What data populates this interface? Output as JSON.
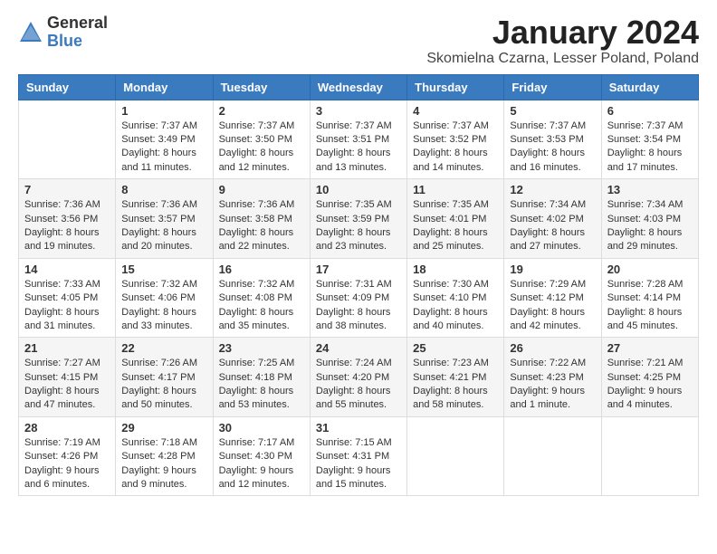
{
  "header": {
    "logo_general": "General",
    "logo_blue": "Blue",
    "month_title": "January 2024",
    "subtitle": "Skomielna Czarna, Lesser Poland, Poland"
  },
  "weekdays": [
    "Sunday",
    "Monday",
    "Tuesday",
    "Wednesday",
    "Thursday",
    "Friday",
    "Saturday"
  ],
  "weeks": [
    [
      {
        "day": "",
        "info": ""
      },
      {
        "day": "1",
        "info": "Sunrise: 7:37 AM\nSunset: 3:49 PM\nDaylight: 8 hours\nand 11 minutes."
      },
      {
        "day": "2",
        "info": "Sunrise: 7:37 AM\nSunset: 3:50 PM\nDaylight: 8 hours\nand 12 minutes."
      },
      {
        "day": "3",
        "info": "Sunrise: 7:37 AM\nSunset: 3:51 PM\nDaylight: 8 hours\nand 13 minutes."
      },
      {
        "day": "4",
        "info": "Sunrise: 7:37 AM\nSunset: 3:52 PM\nDaylight: 8 hours\nand 14 minutes."
      },
      {
        "day": "5",
        "info": "Sunrise: 7:37 AM\nSunset: 3:53 PM\nDaylight: 8 hours\nand 16 minutes."
      },
      {
        "day": "6",
        "info": "Sunrise: 7:37 AM\nSunset: 3:54 PM\nDaylight: 8 hours\nand 17 minutes."
      }
    ],
    [
      {
        "day": "7",
        "info": "Sunrise: 7:36 AM\nSunset: 3:56 PM\nDaylight: 8 hours\nand 19 minutes."
      },
      {
        "day": "8",
        "info": "Sunrise: 7:36 AM\nSunset: 3:57 PM\nDaylight: 8 hours\nand 20 minutes."
      },
      {
        "day": "9",
        "info": "Sunrise: 7:36 AM\nSunset: 3:58 PM\nDaylight: 8 hours\nand 22 minutes."
      },
      {
        "day": "10",
        "info": "Sunrise: 7:35 AM\nSunset: 3:59 PM\nDaylight: 8 hours\nand 23 minutes."
      },
      {
        "day": "11",
        "info": "Sunrise: 7:35 AM\nSunset: 4:01 PM\nDaylight: 8 hours\nand 25 minutes."
      },
      {
        "day": "12",
        "info": "Sunrise: 7:34 AM\nSunset: 4:02 PM\nDaylight: 8 hours\nand 27 minutes."
      },
      {
        "day": "13",
        "info": "Sunrise: 7:34 AM\nSunset: 4:03 PM\nDaylight: 8 hours\nand 29 minutes."
      }
    ],
    [
      {
        "day": "14",
        "info": "Sunrise: 7:33 AM\nSunset: 4:05 PM\nDaylight: 8 hours\nand 31 minutes."
      },
      {
        "day": "15",
        "info": "Sunrise: 7:32 AM\nSunset: 4:06 PM\nDaylight: 8 hours\nand 33 minutes."
      },
      {
        "day": "16",
        "info": "Sunrise: 7:32 AM\nSunset: 4:08 PM\nDaylight: 8 hours\nand 35 minutes."
      },
      {
        "day": "17",
        "info": "Sunrise: 7:31 AM\nSunset: 4:09 PM\nDaylight: 8 hours\nand 38 minutes."
      },
      {
        "day": "18",
        "info": "Sunrise: 7:30 AM\nSunset: 4:10 PM\nDaylight: 8 hours\nand 40 minutes."
      },
      {
        "day": "19",
        "info": "Sunrise: 7:29 AM\nSunset: 4:12 PM\nDaylight: 8 hours\nand 42 minutes."
      },
      {
        "day": "20",
        "info": "Sunrise: 7:28 AM\nSunset: 4:14 PM\nDaylight: 8 hours\nand 45 minutes."
      }
    ],
    [
      {
        "day": "21",
        "info": "Sunrise: 7:27 AM\nSunset: 4:15 PM\nDaylight: 8 hours\nand 47 minutes."
      },
      {
        "day": "22",
        "info": "Sunrise: 7:26 AM\nSunset: 4:17 PM\nDaylight: 8 hours\nand 50 minutes."
      },
      {
        "day": "23",
        "info": "Sunrise: 7:25 AM\nSunset: 4:18 PM\nDaylight: 8 hours\nand 53 minutes."
      },
      {
        "day": "24",
        "info": "Sunrise: 7:24 AM\nSunset: 4:20 PM\nDaylight: 8 hours\nand 55 minutes."
      },
      {
        "day": "25",
        "info": "Sunrise: 7:23 AM\nSunset: 4:21 PM\nDaylight: 8 hours\nand 58 minutes."
      },
      {
        "day": "26",
        "info": "Sunrise: 7:22 AM\nSunset: 4:23 PM\nDaylight: 9 hours\nand 1 minute."
      },
      {
        "day": "27",
        "info": "Sunrise: 7:21 AM\nSunset: 4:25 PM\nDaylight: 9 hours\nand 4 minutes."
      }
    ],
    [
      {
        "day": "28",
        "info": "Sunrise: 7:19 AM\nSunset: 4:26 PM\nDaylight: 9 hours\nand 6 minutes."
      },
      {
        "day": "29",
        "info": "Sunrise: 7:18 AM\nSunset: 4:28 PM\nDaylight: 9 hours\nand 9 minutes."
      },
      {
        "day": "30",
        "info": "Sunrise: 7:17 AM\nSunset: 4:30 PM\nDaylight: 9 hours\nand 12 minutes."
      },
      {
        "day": "31",
        "info": "Sunrise: 7:15 AM\nSunset: 4:31 PM\nDaylight: 9 hours\nand 15 minutes."
      },
      {
        "day": "",
        "info": ""
      },
      {
        "day": "",
        "info": ""
      },
      {
        "day": "",
        "info": ""
      }
    ]
  ]
}
